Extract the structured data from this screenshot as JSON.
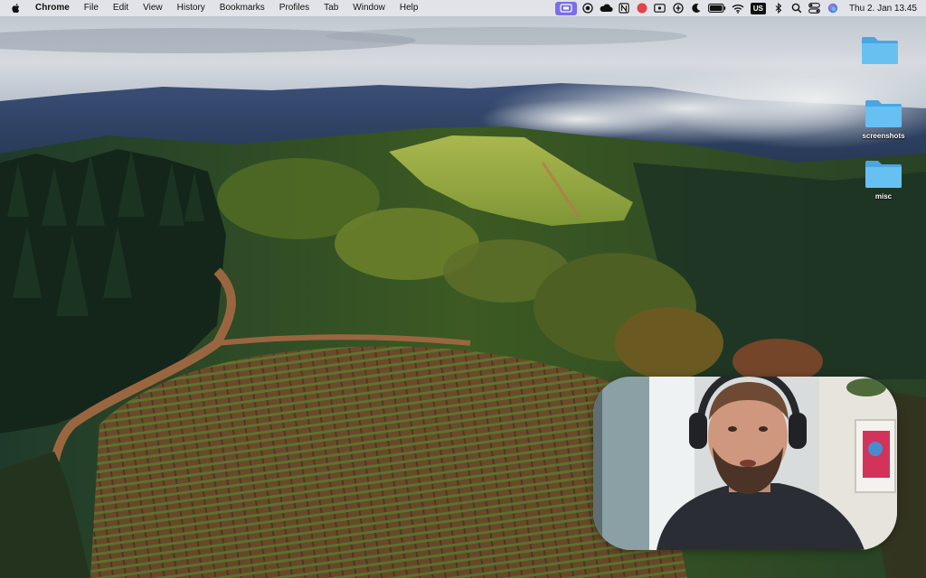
{
  "menubar": {
    "app_name": "Chrome",
    "menus": [
      "File",
      "Edit",
      "View",
      "History",
      "Bookmarks",
      "Profiles",
      "Tab",
      "Window",
      "Help"
    ],
    "tray_icons": [
      "screen-record-icon",
      "record-dot-icon",
      "cloud-icon",
      "notion-icon",
      "red-circle-icon",
      "display-icon",
      "vpn-icon",
      "moon-icon",
      "battery-icon",
      "wifi-icon",
      "keyboard-layout-icon",
      "bluetooth-icon",
      "search-icon",
      "control-center-icon",
      "siri-icon"
    ],
    "keyboard_layout": "US",
    "clock": "Thu 2. Jan  13.45",
    "active_accent": "#7a6fe6"
  },
  "desktop": {
    "icons": [
      {
        "name": "folder-icon",
        "label": ""
      },
      {
        "name": "folder-icon",
        "label": "screenshots"
      },
      {
        "name": "folder-icon",
        "label": "misc"
      }
    ],
    "folder_color": "#5bb8ef"
  },
  "camera_overlay": {
    "description_icon": "webcam-feed-icon"
  }
}
